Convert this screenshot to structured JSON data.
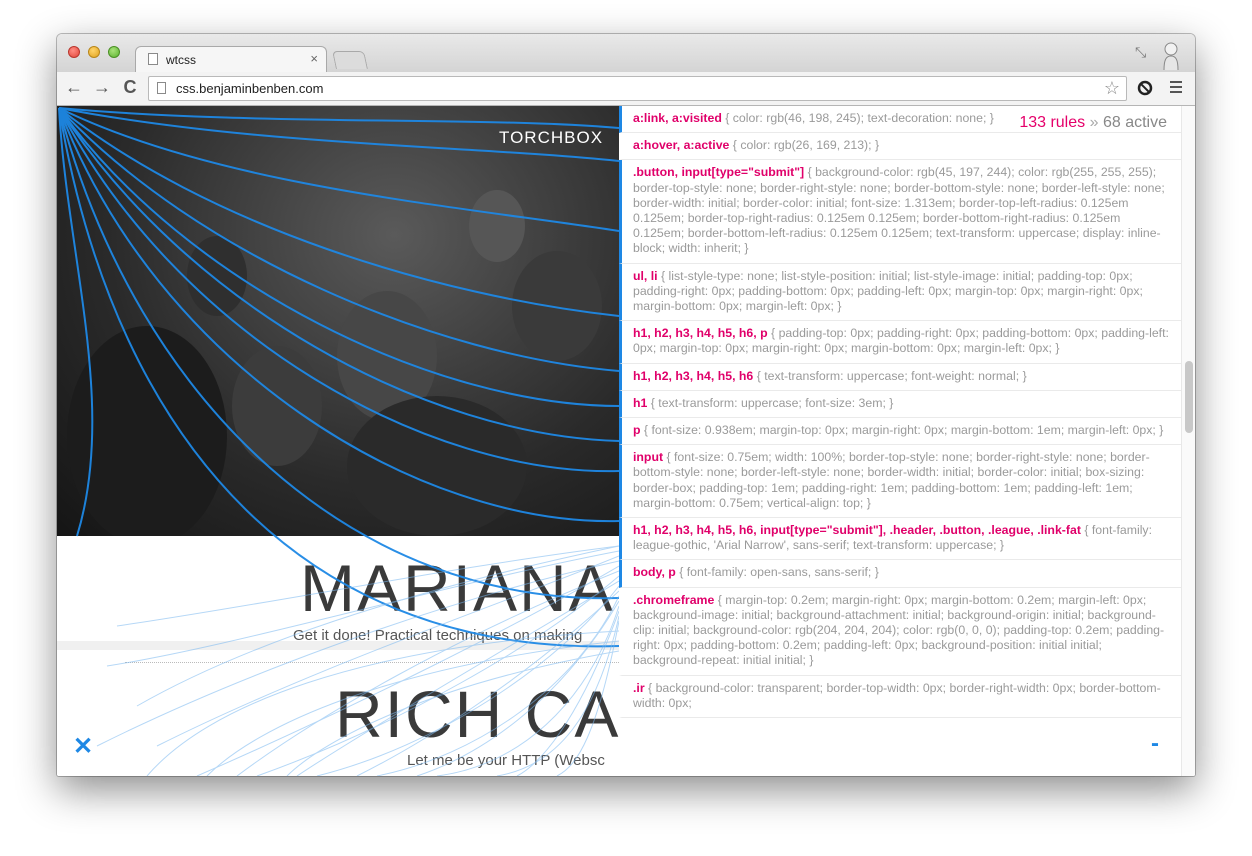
{
  "browser": {
    "tab_title": "wtcss",
    "tab_close": "×",
    "url": "css.benjaminbenben.com",
    "back": "←",
    "forward": "→",
    "reload": "C",
    "star": "☆",
    "restore": "⤡"
  },
  "page": {
    "logo_text": "TORCHBOX",
    "talks": [
      {
        "name": "MARIANA",
        "tagline": "Get it done! Practical techniques on making"
      },
      {
        "name": "RICH CAU",
        "tagline": "Let me be your HTTP (Websc"
      }
    ],
    "close_label": "✕"
  },
  "panel": {
    "total": "133 rules",
    "separator": "»",
    "active": "68 active",
    "rules": [
      {
        "selector": "a:link, a:visited",
        "body": " { color: rgb(46, 198, 245); text-decoration: none; }",
        "active": true
      },
      {
        "selector": "a:hover, a:active",
        "body": " { color: rgb(26, 169, 213); }",
        "active": false
      },
      {
        "selector": ".button, input[type=\"submit\"]",
        "body": " { background-color: rgb(45, 197, 244); color: rgb(255, 255, 255); border-top-style: none; border-right-style: none; border-bottom-style: none; border-left-style: none; border-width: initial; border-color: initial; font-size: 1.313em; border-top-left-radius: 0.125em 0.125em; border-top-right-radius: 0.125em 0.125em; border-bottom-right-radius: 0.125em 0.125em; border-bottom-left-radius: 0.125em 0.125em; text-transform: uppercase; display: inline-block; width: inherit; }",
        "active": true
      },
      {
        "selector": "ul, li",
        "body": " { list-style-type: none; list-style-position: initial; list-style-image: initial; padding-top: 0px; padding-right: 0px; padding-bottom: 0px; padding-left: 0px; margin-top: 0px; margin-right: 0px; margin-bottom: 0px; margin-left: 0px; }",
        "active": true
      },
      {
        "selector": "h1, h2, h3, h4, h5, h6, p",
        "body": " { padding-top: 0px; padding-right: 0px; padding-bottom: 0px; padding-left: 0px; margin-top: 0px; margin-right: 0px; margin-bottom: 0px; margin-left: 0px; }",
        "active": true
      },
      {
        "selector": "h1, h2, h3, h4, h5, h6",
        "body": " { text-transform: uppercase; font-weight: normal; }",
        "active": true
      },
      {
        "selector": "h1",
        "body": " { text-transform: uppercase; font-size: 3em; }",
        "active": true
      },
      {
        "selector": "p",
        "body": " { font-size: 0.938em; margin-top: 0px; margin-right: 0px; margin-bottom: 1em; margin-left: 0px; }",
        "active": true
      },
      {
        "selector": "input",
        "body": " { font-size: 0.75em; width: 100%; border-top-style: none; border-right-style: none; border-bottom-style: none; border-left-style: none; border-width: initial; border-color: initial; box-sizing: border-box; padding-top: 1em; padding-right: 1em; padding-bottom: 1em; padding-left: 1em; margin-bottom: 0.75em; vertical-align: top; }",
        "active": true
      },
      {
        "selector": "h1, h2, h3, h4, h5, h6, input[type=\"submit\"], .header, .button, .league, .link-fat",
        "body": " { font-family: league-gothic, 'Arial Narrow', sans-serif; text-transform: uppercase; }",
        "active": true
      },
      {
        "selector": "body, p",
        "body": " { font-family: open-sans, sans-serif; }",
        "active": true
      },
      {
        "selector": ".chromeframe",
        "body": " { margin-top: 0.2em; margin-right: 0px; margin-bottom: 0.2em; margin-left: 0px; background-image: initial; background-attachment: initial; background-origin: initial; background-clip: initial; background-color: rgb(204, 204, 204); color: rgb(0, 0, 0); padding-top: 0.2em; padding-right: 0px; padding-bottom: 0.2em; padding-left: 0px; background-position: initial initial; background-repeat: initial initial; }",
        "active": false
      },
      {
        "selector": ".ir",
        "body": " { background-color: transparent; border-top-width: 0px; border-right-width: 0px; border-bottom-width: 0px;",
        "active": false
      }
    ],
    "minus_label": "-"
  },
  "colors": {
    "accent": "#1e88e5",
    "selector": "#e0006a",
    "curve": "#1e88e5"
  }
}
